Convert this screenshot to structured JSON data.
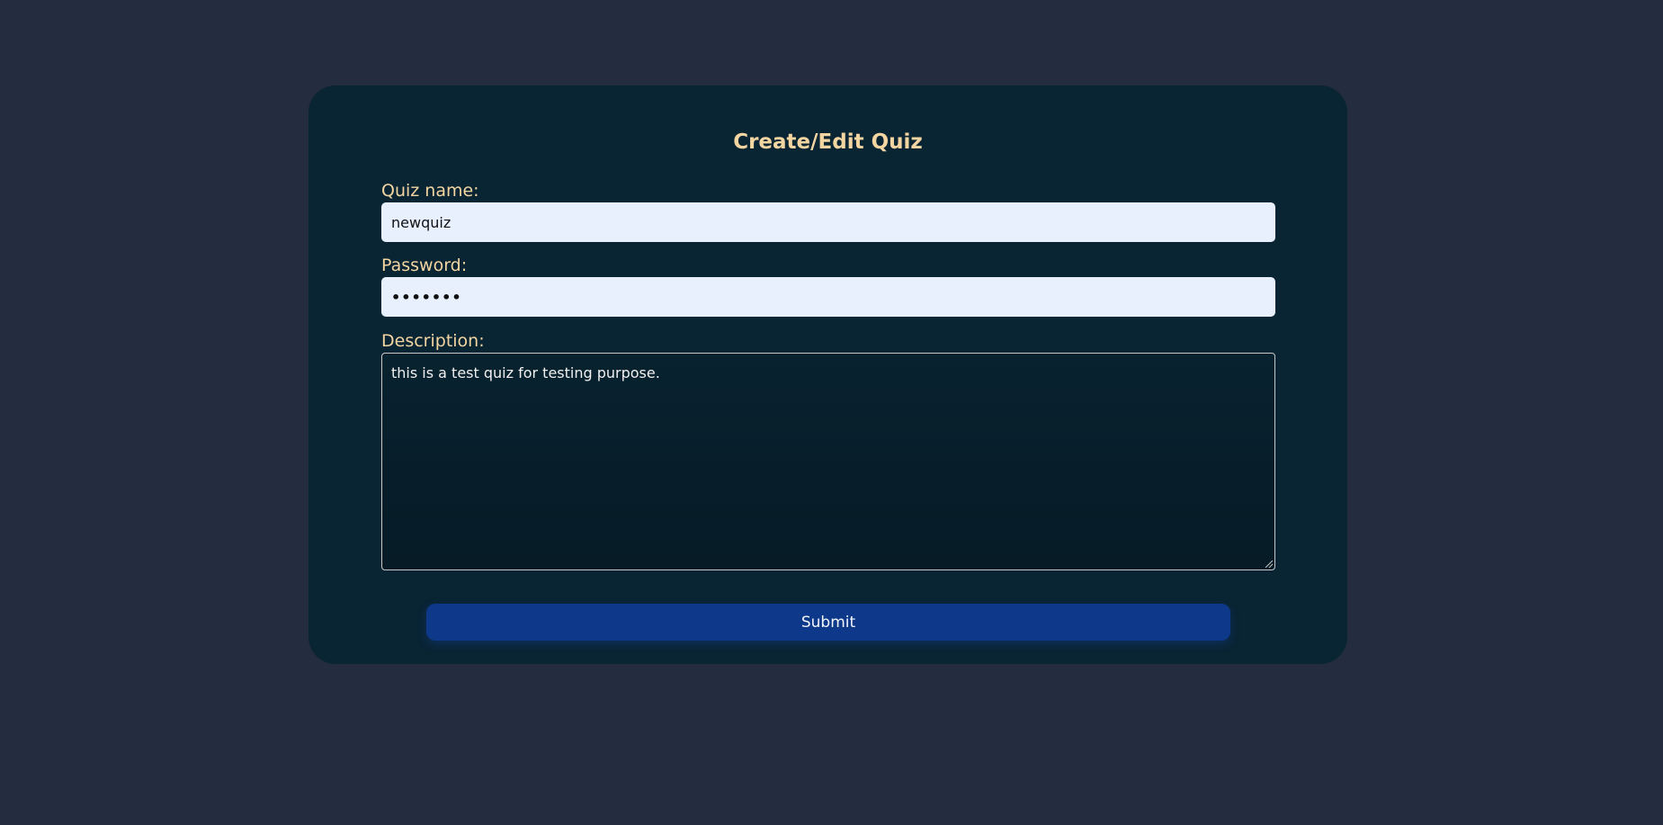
{
  "form": {
    "title": "Create/Edit Quiz",
    "quiz_name": {
      "label": "Quiz name:",
      "value": "newquiz"
    },
    "password": {
      "label": "Password:",
      "masked_value": "•••••••"
    },
    "description": {
      "label": "Description:",
      "value": "this is a test quiz for testing purpose."
    },
    "submit_label": "Submit"
  },
  "colors": {
    "page_background": "#242c40",
    "card_background": "#092433",
    "label_color": "#f3d5a2",
    "input_background": "#e8f0fe",
    "submit_background": "#0e398a"
  }
}
